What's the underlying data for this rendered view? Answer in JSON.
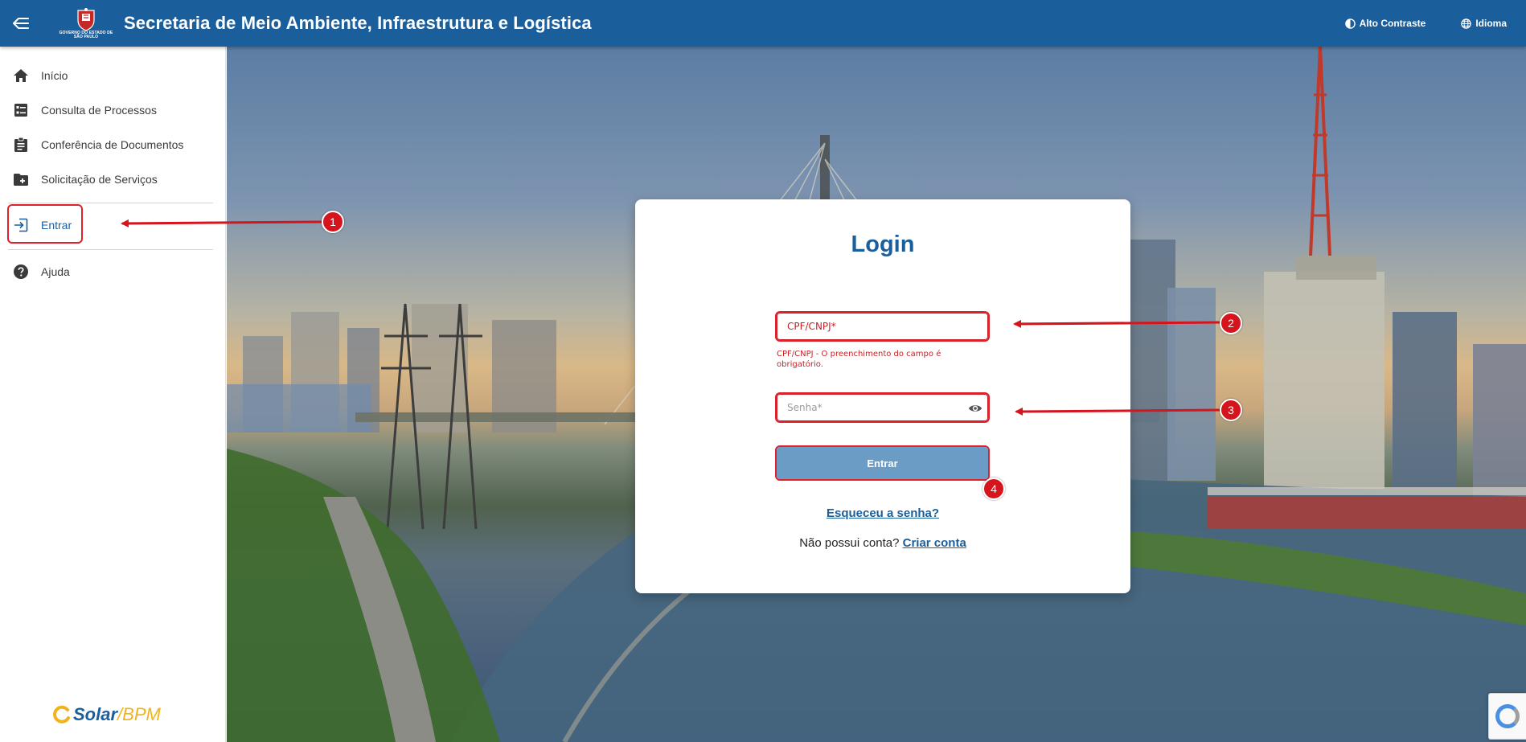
{
  "header": {
    "title": "Secretaria de Meio Ambiente, Infraestrutura e Logística",
    "gov_logo_text": "GOVERNO DO ESTADO DE SÃO PAULO",
    "high_contrast_label": "Alto Contraste",
    "language_label": "Idioma"
  },
  "sidebar": {
    "items": [
      {
        "label": "Início",
        "icon": "home-icon"
      },
      {
        "label": "Consulta de Processos",
        "icon": "list-icon"
      },
      {
        "label": "Conferência de Documentos",
        "icon": "clipboard-icon"
      },
      {
        "label": "Solicitação de Serviços",
        "icon": "folder-add-icon"
      },
      {
        "label": "Entrar",
        "icon": "login-icon"
      },
      {
        "label": "Ajuda",
        "icon": "help-icon"
      }
    ],
    "brand": {
      "solar": "Solar",
      "slash": "/",
      "bpm": "BPM"
    }
  },
  "login": {
    "title": "Login",
    "cpf_placeholder": "CPF/CNPJ*",
    "cpf_error": "CPF/CNPJ - O preenchimento do campo é obrigatório.",
    "password_placeholder": "Senha*",
    "submit_label": "Entrar",
    "forgot_label": "Esqueceu a senha?",
    "no_account_text": "Não possui conta?",
    "create_account_label": "Criar conta"
  },
  "annotations": {
    "badges": [
      "1",
      "2",
      "3",
      "4"
    ],
    "color": "#d6141d"
  },
  "colors": {
    "primary": "#1b5e9c",
    "button": "#6b9cc6",
    "error": "#c91f24",
    "accent": "#f2b21b"
  }
}
